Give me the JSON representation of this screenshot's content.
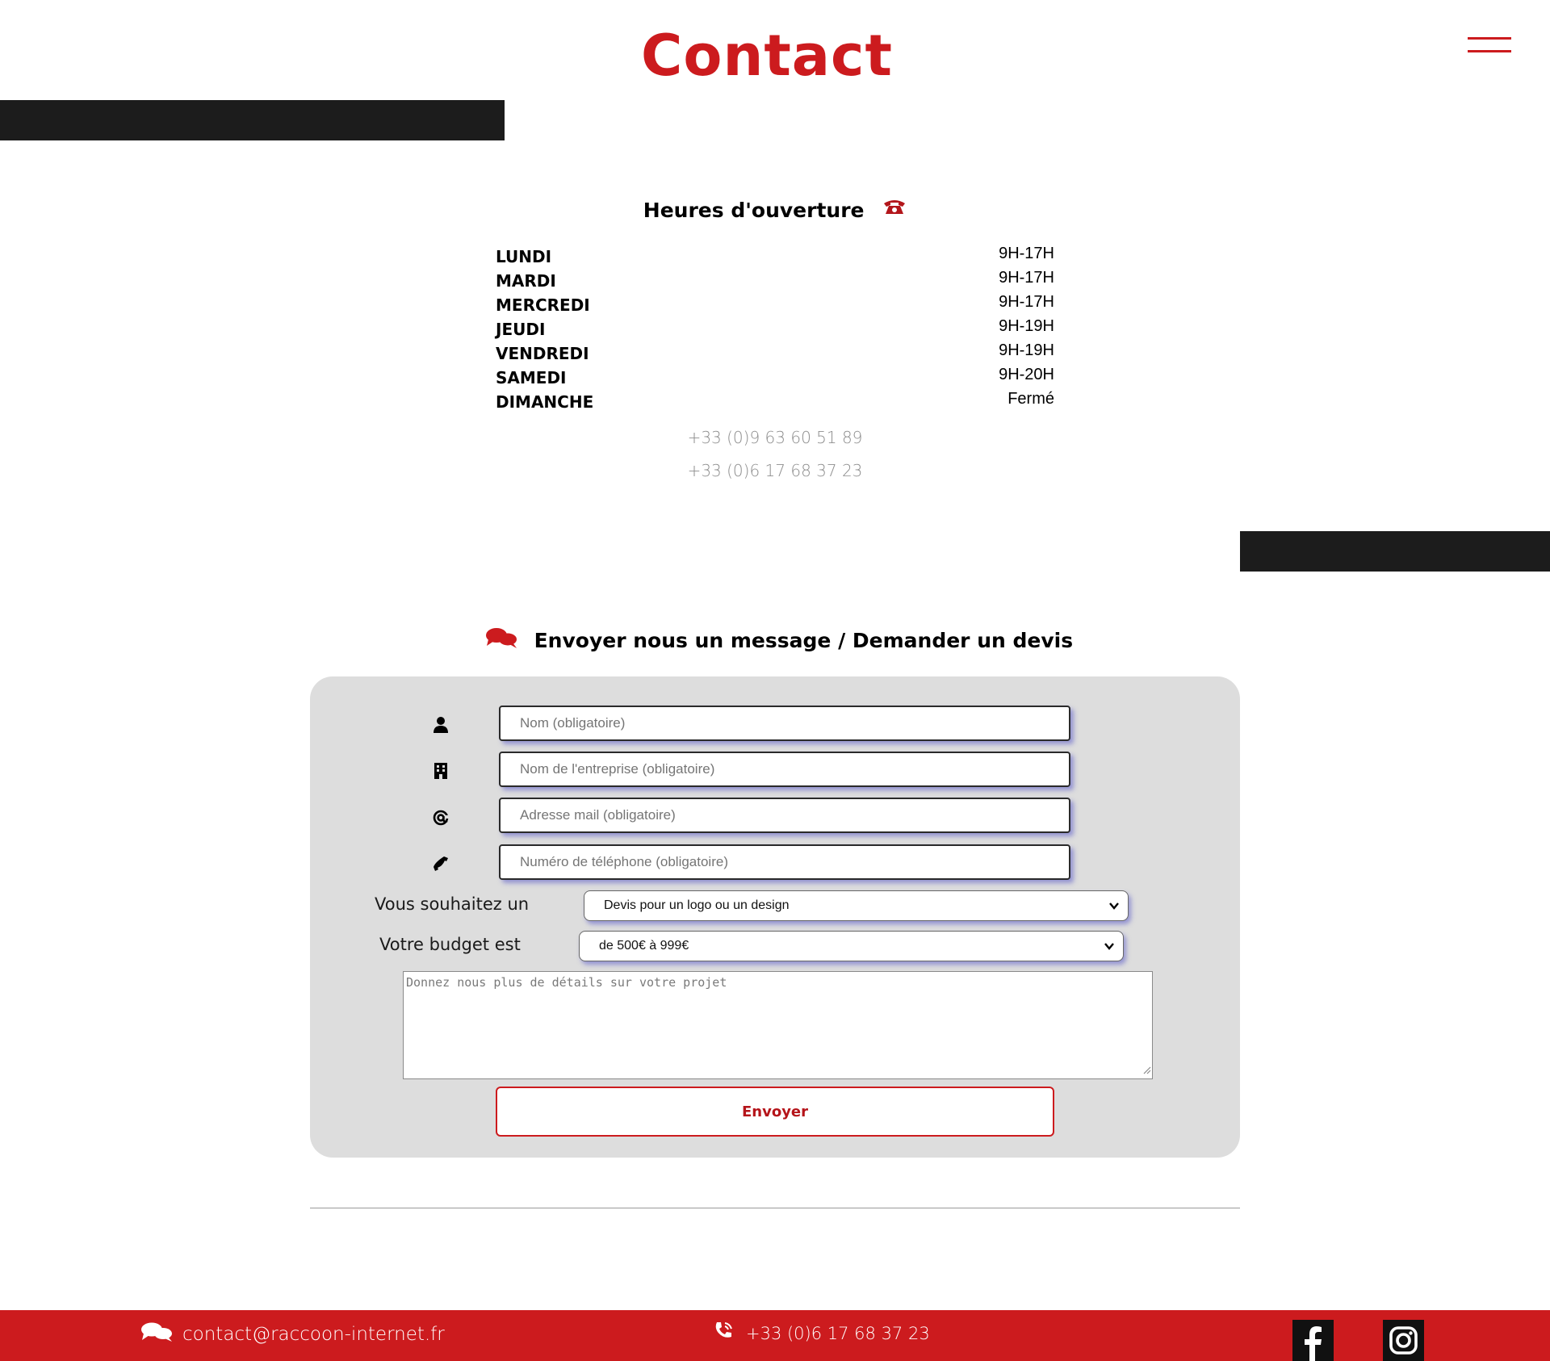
{
  "header": {
    "title": "Contact",
    "menu_icon": "hamburger-menu-icon"
  },
  "hours": {
    "title": "Heures d'ouverture",
    "title_icon": "telephone-icon",
    "rows": [
      {
        "day": "LUNDI",
        "time": "9H-17H"
      },
      {
        "day": "MARDI",
        "time": "9H-17H"
      },
      {
        "day": "MERCREDI",
        "time": "9H-17H"
      },
      {
        "day": "JEUDI",
        "time": "9H-19H"
      },
      {
        "day": "VENDREDI",
        "time": "9H-19H"
      },
      {
        "day": "SAMEDI",
        "time": "9H-20H"
      },
      {
        "day": "DIMANCHE",
        "time": "Fermé"
      }
    ],
    "phones": [
      "+33 (0)9 63 60 51 89",
      "+33 (0)6 17 68 37 23"
    ]
  },
  "form": {
    "title": "Envoyer nous un message / Demander un devis",
    "title_icon": "chat-bubbles-icon",
    "fields": {
      "name_placeholder": "Nom (obligatoire)",
      "company_placeholder": "Nom de l'entreprise (obligatoire)",
      "email_placeholder": "Adresse mail (obligatoire)",
      "phone_placeholder": "Numéro de téléphone (obligatoire)"
    },
    "wish": {
      "label": "Vous souhaitez un",
      "selected": "Devis pour un logo ou un design"
    },
    "budget": {
      "label": "Votre budget est",
      "selected": "de 500€ à 999€"
    },
    "details_placeholder": "Donnez nous plus de détails sur votre projet",
    "submit_label": "Envoyer"
  },
  "footer": {
    "email": "contact@raccoon-internet.fr",
    "phone": "+33 (0)6 17 68 37 23",
    "social": [
      "facebook-icon",
      "instagram-icon"
    ]
  },
  "colors": {
    "brand_red": "#cc1b1e",
    "band_dark": "#1c1c1c",
    "form_bg": "#dddddd"
  }
}
